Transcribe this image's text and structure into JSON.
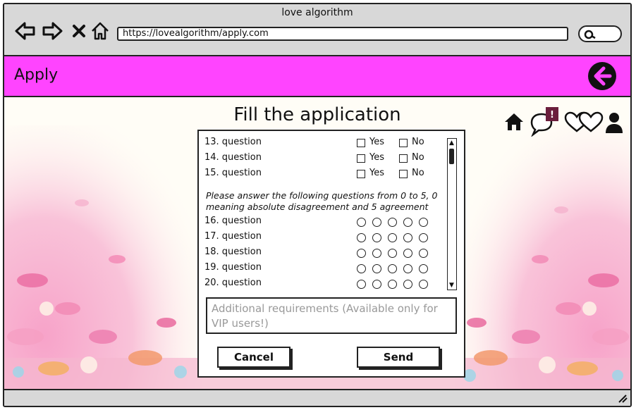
{
  "browser": {
    "title": "love algorithm",
    "url": "https://lovealgorithm/apply.com",
    "nav_icons": [
      "back-arrow-icon",
      "forward-arrow-icon",
      "close-x-icon",
      "home-outline-icon"
    ]
  },
  "app_bar": {
    "title": "Apply",
    "back_icon": "arrow-left-circle-icon",
    "color": "#ff44ff"
  },
  "page": {
    "heading": "Fill the application",
    "top_icons": [
      "home-icon",
      "chat-bubble-icon",
      "hearts-icon",
      "user-icon"
    ],
    "notification_badge": "!"
  },
  "form": {
    "yes_no_questions": [
      {
        "label": "13. question",
        "yes": "Yes",
        "no": "No"
      },
      {
        "label": "14. question",
        "yes": "Yes",
        "no": "No"
      },
      {
        "label": "15. question",
        "yes": "Yes",
        "no": "No"
      }
    ],
    "instructions": "Please answer the following questions from 0 to 5, 0 meaning absolute disagreement and 5 agreement",
    "scale_questions": [
      {
        "label": "16. question"
      },
      {
        "label": "17. question"
      },
      {
        "label": "18. question"
      },
      {
        "label": "19. question"
      },
      {
        "label": "20. question"
      }
    ],
    "requirements_text": "Additional requirements (Available only for VIP users!)",
    "cancel_label": "Cancel",
    "send_label": "Send"
  }
}
